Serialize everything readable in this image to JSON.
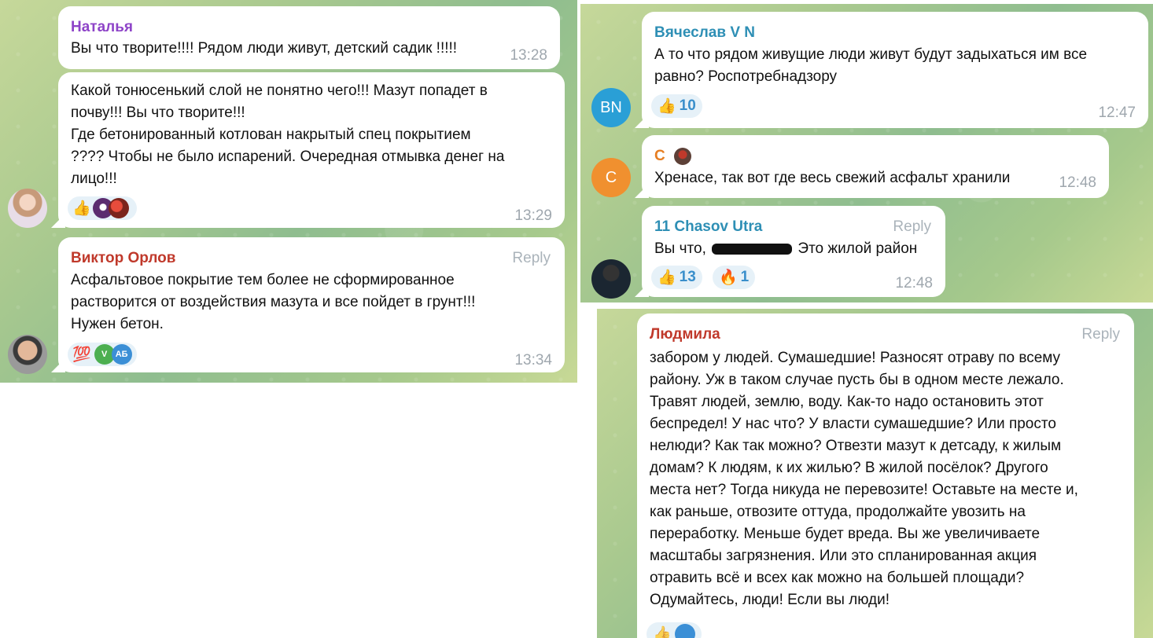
{
  "panel1": {
    "m1": {
      "author": "Наталья",
      "author_color": "#8e44c8",
      "text": "Вы что творите!!!! Рядом люди живут, детский садик !!!!!",
      "time": "13:28"
    },
    "m2": {
      "text_lines": [
        "Какой тонюсенький слой не понятно чего!!! Мазут попадет в",
        "почву!!! Вы что творите!!!",
        "Где бетонированный котлован накрытый спец покрытием",
        "???? Чтобы не было испарений. Очередная отмывка денег на",
        "лицо!!!"
      ],
      "time": "13:29",
      "reaction_icons": [
        "thumbs-up",
        "sticker-avatar",
        "sticker-avatar"
      ]
    },
    "m3": {
      "author": "Виктор Орлов",
      "author_color": "#c0392b",
      "reply": "Reply",
      "text_lines": [
        "Асфальтовое покрытие тем более не сформированное",
        "растворится от воздействия мазута и все пойдет в грунт!!!",
        "Нужен бетон."
      ],
      "time": "13:34",
      "reaction_emoji": "💯",
      "reactor_initials": [
        "V",
        "АБ"
      ],
      "reactor_colors": [
        "#4caf50",
        "#3b8fd6"
      ]
    }
  },
  "panel2": {
    "m1": {
      "author": "Вячеслав V N",
      "author_color": "#2e8fb5",
      "avatar_initials": "BN",
      "avatar_color": "#2a9fd6",
      "text_lines": [
        "А то что рядом живущие люди живут будут задыхаться им все",
        "равно? Роспотребнадзору"
      ],
      "reaction_emoji": "👍",
      "reaction_count": "10",
      "time": "12:47"
    },
    "m2": {
      "author": "С",
      "author_color": "#e67e22",
      "avatar_initials": "C",
      "avatar_color": "#f0902f",
      "text": "Хренасе, так вот где весь свежий асфальт хранили",
      "time": "12:48"
    },
    "m3": {
      "author": "11 Chasov Utra",
      "author_color": "#2e8fb5",
      "reply": "Reply",
      "text_before": "Вы что,",
      "text_after": "Это жилой район",
      "reaction1_emoji": "👍",
      "reaction1_count": "13",
      "reaction2_emoji": "🔥",
      "reaction2_count": "1",
      "time": "12:48"
    }
  },
  "panel3": {
    "m1": {
      "author": "Людмила",
      "author_color": "#c0392b",
      "reply": "Reply",
      "text_lines": [
        "забором у людей. Сумашедшие! Разносят отраву по всему",
        "району. Уж в таком случае пусть бы в одном месте лежало.",
        "Травят людей, землю, воду. Как-то надо остановить этот",
        "беспредел! У нас что? У власти сумашедшие? Или просто",
        "нелюди? Как так можно? Отвезти мазут к детсаду, к жилым",
        "домам? К людям, к их жилью? В жилой посёлок? Другого",
        "места нет? Тогда никуда не перевозите! Оставьте на месте и,",
        "как раньше, отвозите оттуда, продолжайте увозить на",
        "переработку. Меньше будет вреда. Вы же увеличиваете",
        "масштабы загрязнения. Или это спланированная акция",
        "отравить всё и всех как можно на большей площади?",
        "Одумайтесь, люди! Если вы люди!"
      ]
    }
  }
}
